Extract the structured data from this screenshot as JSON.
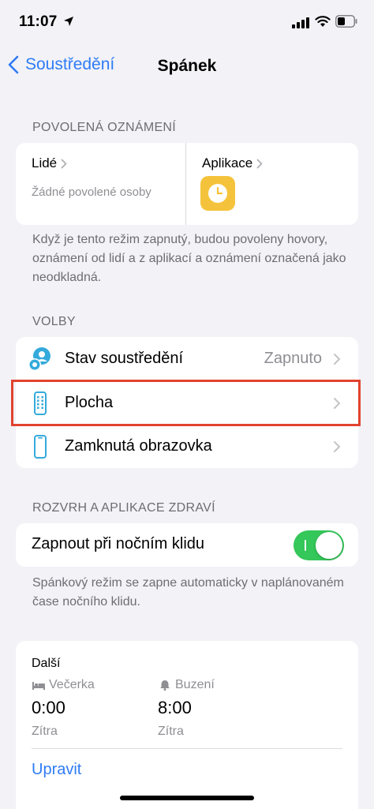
{
  "status_bar": {
    "time": "11:07"
  },
  "nav": {
    "back_label": "Soustředění",
    "title": "Spánek"
  },
  "allowed": {
    "header": "POVOLENÁ OZNÁMENÍ",
    "people": {
      "title": "Lidé",
      "subtitle": "Žádné povolené osoby"
    },
    "apps": {
      "title": "Aplikace",
      "app_icon": "clock-icon"
    },
    "footer": "Když je tento režim zapnutý, budou povoleny hovory, oznámení od lidí a z aplikací a oznámení označená jako neodkladná."
  },
  "options": {
    "header": "VOLBY",
    "items": [
      {
        "label": "Stav soustředění",
        "value": "Zapnuto",
        "icon": "focus-status-icon"
      },
      {
        "label": "Plocha",
        "value": "",
        "icon": "home-screen-icon",
        "highlighted": true
      },
      {
        "label": "Zamknutá obrazovka",
        "value": "",
        "icon": "lock-screen-icon"
      }
    ]
  },
  "schedule_section": {
    "header": "ROZVRH A APLIKACE ZDRAVÍ",
    "toggle_label": "Zapnout při nočním klidu",
    "toggle_on": true,
    "footer": "Spánkový režim se zapne automaticky v naplánovaném čase nočního klidu."
  },
  "schedule_card": {
    "title": "Další",
    "bedtime": {
      "label": "Večerka",
      "time": "0:00",
      "day": "Zítra"
    },
    "wake": {
      "label": "Buzení",
      "time": "8:00",
      "day": "Zítra"
    },
    "edit_label": "Upravit"
  },
  "colors": {
    "accent": "#2f7cf6",
    "toggle_on": "#34c759",
    "app_icon_bg": "#f5c33b",
    "icon_teal": "#34aadc",
    "highlight_border": "#e1432f",
    "background": "#f2f2f7"
  }
}
